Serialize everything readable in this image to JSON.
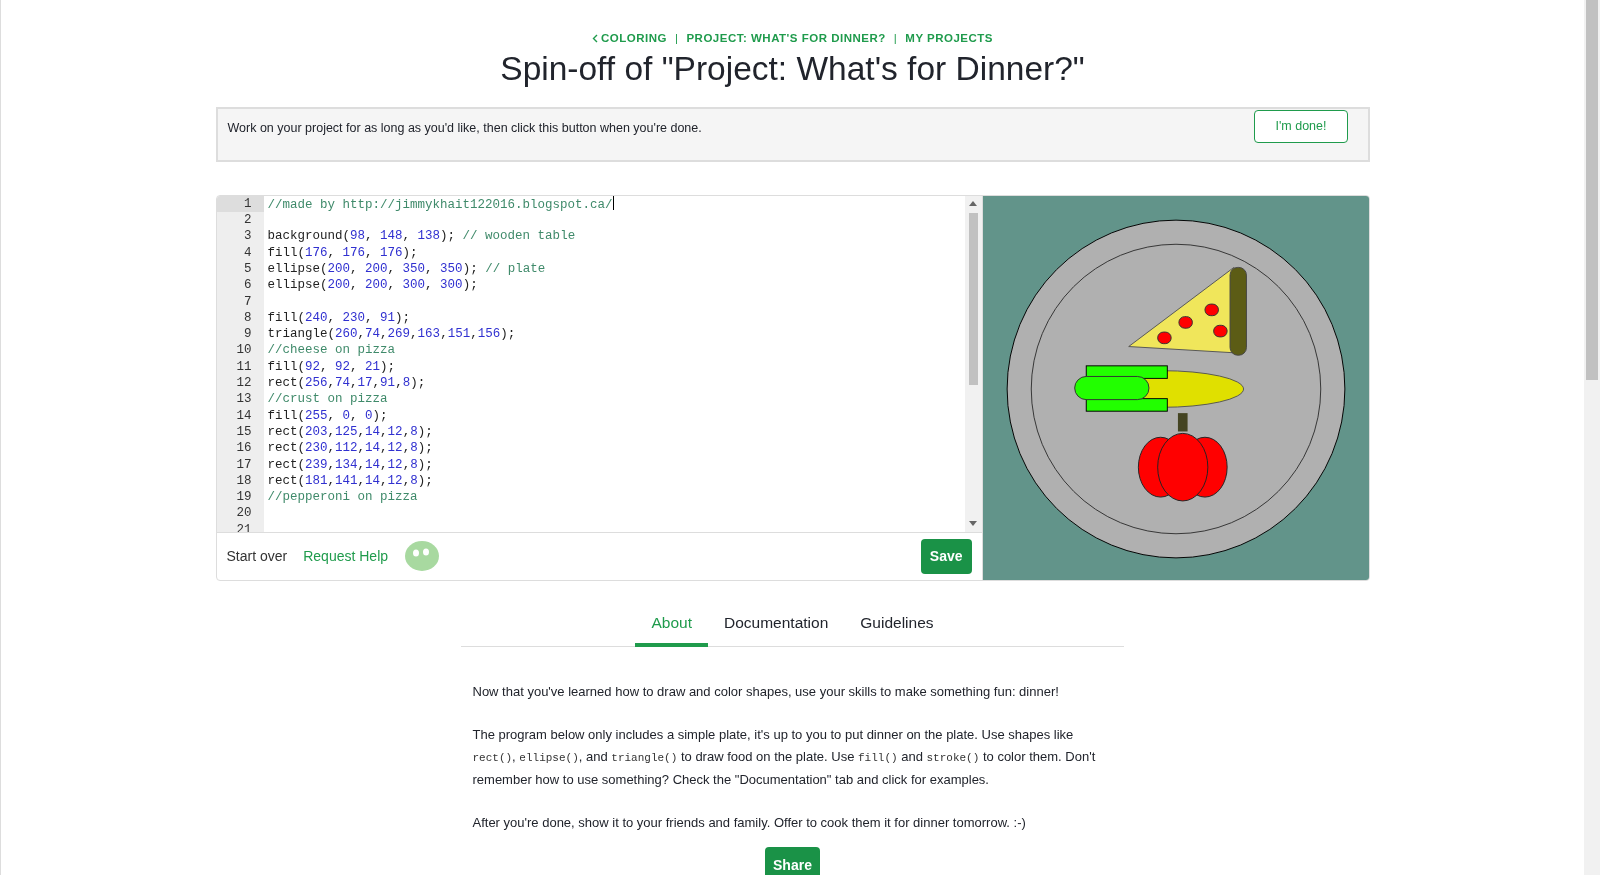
{
  "breadcrumbs": [
    {
      "kind": "back",
      "text": "COLORING"
    },
    {
      "kind": "separator",
      "text": "|"
    },
    {
      "kind": "link",
      "text": "PROJECT: WHAT'S FOR DINNER?"
    },
    {
      "kind": "separator",
      "text": "|"
    },
    {
      "kind": "link",
      "text": "MY PROJECTS"
    }
  ],
  "title": "Spin-off of \"Project: What's for Dinner?\"",
  "instructions": {
    "text": "Work on your project for as long as you'd like, then click this button when you're done.",
    "button": "I'm done!"
  },
  "editor": {
    "lines": [
      {
        "number": "1",
        "active": true,
        "tokens": [
          {
            "kind": "comment",
            "text": "//made by http://jimmykhait122016.blogspot.ca/"
          }
        ]
      },
      {
        "number": "2",
        "active": false
      },
      {
        "number": "3",
        "active": false,
        "tokens": [
          {
            "kind": "plain",
            "text": "background("
          },
          {
            "kind": "number",
            "text": "98"
          },
          {
            "kind": "plain",
            "text": ", "
          },
          {
            "kind": "number",
            "text": "148"
          },
          {
            "kind": "plain",
            "text": ", "
          },
          {
            "kind": "number",
            "text": "138"
          },
          {
            "kind": "plain",
            "text": "); "
          },
          {
            "kind": "comment",
            "text": "// wooden table"
          }
        ]
      },
      {
        "number": "4",
        "active": false,
        "tokens": [
          {
            "kind": "plain",
            "text": "fill("
          },
          {
            "kind": "number",
            "text": "176"
          },
          {
            "kind": "plain",
            "text": ", "
          },
          {
            "kind": "number",
            "text": "176"
          },
          {
            "kind": "plain",
            "text": ", "
          },
          {
            "kind": "number",
            "text": "176"
          },
          {
            "kind": "plain",
            "text": ");"
          }
        ]
      },
      {
        "number": "5",
        "active": false,
        "tokens": [
          {
            "kind": "plain",
            "text": "ellipse("
          },
          {
            "kind": "number",
            "text": "200"
          },
          {
            "kind": "plain",
            "text": ", "
          },
          {
            "kind": "number",
            "text": "200"
          },
          {
            "kind": "plain",
            "text": ", "
          },
          {
            "kind": "number",
            "text": "350"
          },
          {
            "kind": "plain",
            "text": ", "
          },
          {
            "kind": "number",
            "text": "350"
          },
          {
            "kind": "plain",
            "text": "); "
          },
          {
            "kind": "comment",
            "text": "// plate"
          }
        ]
      },
      {
        "number": "6",
        "active": false,
        "tokens": [
          {
            "kind": "plain",
            "text": "ellipse("
          },
          {
            "kind": "number",
            "text": "200"
          },
          {
            "kind": "plain",
            "text": ", "
          },
          {
            "kind": "number",
            "text": "200"
          },
          {
            "kind": "plain",
            "text": ", "
          },
          {
            "kind": "number",
            "text": "300"
          },
          {
            "kind": "plain",
            "text": ", "
          },
          {
            "kind": "number",
            "text": "300"
          },
          {
            "kind": "plain",
            "text": ");"
          }
        ]
      },
      {
        "number": "7",
        "active": false
      },
      {
        "number": "8",
        "active": false,
        "tokens": [
          {
            "kind": "plain",
            "text": "fill("
          },
          {
            "kind": "number",
            "text": "240"
          },
          {
            "kind": "plain",
            "text": ", "
          },
          {
            "kind": "number",
            "text": "230"
          },
          {
            "kind": "plain",
            "text": ", "
          },
          {
            "kind": "number",
            "text": "91"
          },
          {
            "kind": "plain",
            "text": ");"
          }
        ]
      },
      {
        "number": "9",
        "active": false,
        "tokens": [
          {
            "kind": "plain",
            "text": "triangle("
          },
          {
            "kind": "number",
            "text": "260"
          },
          {
            "kind": "plain",
            "text": ","
          },
          {
            "kind": "number",
            "text": "74"
          },
          {
            "kind": "plain",
            "text": ","
          },
          {
            "kind": "number",
            "text": "269"
          },
          {
            "kind": "plain",
            "text": ","
          },
          {
            "kind": "number",
            "text": "163"
          },
          {
            "kind": "plain",
            "text": ","
          },
          {
            "kind": "number",
            "text": "151"
          },
          {
            "kind": "plain",
            "text": ","
          },
          {
            "kind": "number",
            "text": "156"
          },
          {
            "kind": "plain",
            "text": ");"
          }
        ]
      },
      {
        "number": "10",
        "active": false,
        "tokens": [
          {
            "kind": "comment",
            "text": "//cheese on pizza"
          }
        ]
      },
      {
        "number": "11",
        "active": false,
        "tokens": [
          {
            "kind": "plain",
            "text": "fill("
          },
          {
            "kind": "number",
            "text": "92"
          },
          {
            "kind": "plain",
            "text": ", "
          },
          {
            "kind": "number",
            "text": "92"
          },
          {
            "kind": "plain",
            "text": ", "
          },
          {
            "kind": "number",
            "text": "21"
          },
          {
            "kind": "plain",
            "text": ");"
          }
        ]
      },
      {
        "number": "12",
        "active": false,
        "tokens": [
          {
            "kind": "plain",
            "text": "rect("
          },
          {
            "kind": "number",
            "text": "256"
          },
          {
            "kind": "plain",
            "text": ","
          },
          {
            "kind": "number",
            "text": "74"
          },
          {
            "kind": "plain",
            "text": ","
          },
          {
            "kind": "number",
            "text": "17"
          },
          {
            "kind": "plain",
            "text": ","
          },
          {
            "kind": "number",
            "text": "91"
          },
          {
            "kind": "plain",
            "text": ","
          },
          {
            "kind": "number",
            "text": "8"
          },
          {
            "kind": "plain",
            "text": ");"
          }
        ]
      },
      {
        "number": "13",
        "active": false,
        "tokens": [
          {
            "kind": "comment",
            "text": "//crust on pizza"
          }
        ]
      },
      {
        "number": "14",
        "active": false,
        "tokens": [
          {
            "kind": "plain",
            "text": "fill("
          },
          {
            "kind": "number",
            "text": "255"
          },
          {
            "kind": "plain",
            "text": ", "
          },
          {
            "kind": "number",
            "text": "0"
          },
          {
            "kind": "plain",
            "text": ", "
          },
          {
            "kind": "number",
            "text": "0"
          },
          {
            "kind": "plain",
            "text": ");"
          }
        ]
      },
      {
        "number": "15",
        "active": false,
        "tokens": [
          {
            "kind": "plain",
            "text": "rect("
          },
          {
            "kind": "number",
            "text": "203"
          },
          {
            "kind": "plain",
            "text": ","
          },
          {
            "kind": "number",
            "text": "125"
          },
          {
            "kind": "plain",
            "text": ","
          },
          {
            "kind": "number",
            "text": "14"
          },
          {
            "kind": "plain",
            "text": ","
          },
          {
            "kind": "number",
            "text": "12"
          },
          {
            "kind": "plain",
            "text": ","
          },
          {
            "kind": "number",
            "text": "8"
          },
          {
            "kind": "plain",
            "text": ");"
          }
        ]
      },
      {
        "number": "16",
        "active": false,
        "tokens": [
          {
            "kind": "plain",
            "text": "rect("
          },
          {
            "kind": "number",
            "text": "230"
          },
          {
            "kind": "plain",
            "text": ","
          },
          {
            "kind": "number",
            "text": "112"
          },
          {
            "kind": "plain",
            "text": ","
          },
          {
            "kind": "number",
            "text": "14"
          },
          {
            "kind": "plain",
            "text": ","
          },
          {
            "kind": "number",
            "text": "12"
          },
          {
            "kind": "plain",
            "text": ","
          },
          {
            "kind": "number",
            "text": "8"
          },
          {
            "kind": "plain",
            "text": ");"
          }
        ]
      },
      {
        "number": "17",
        "active": false,
        "tokens": [
          {
            "kind": "plain",
            "text": "rect("
          },
          {
            "kind": "number",
            "text": "239"
          },
          {
            "kind": "plain",
            "text": ","
          },
          {
            "kind": "number",
            "text": "134"
          },
          {
            "kind": "plain",
            "text": ","
          },
          {
            "kind": "number",
            "text": "14"
          },
          {
            "kind": "plain",
            "text": ","
          },
          {
            "kind": "number",
            "text": "12"
          },
          {
            "kind": "plain",
            "text": ","
          },
          {
            "kind": "number",
            "text": "8"
          },
          {
            "kind": "plain",
            "text": ");"
          }
        ]
      },
      {
        "number": "18",
        "active": false,
        "tokens": [
          {
            "kind": "plain",
            "text": "rect("
          },
          {
            "kind": "number",
            "text": "181"
          },
          {
            "kind": "plain",
            "text": ","
          },
          {
            "kind": "number",
            "text": "141"
          },
          {
            "kind": "plain",
            "text": ","
          },
          {
            "kind": "number",
            "text": "14"
          },
          {
            "kind": "plain",
            "text": ","
          },
          {
            "kind": "number",
            "text": "12"
          },
          {
            "kind": "plain",
            "text": ","
          },
          {
            "kind": "number",
            "text": "8"
          },
          {
            "kind": "plain",
            "text": ");"
          }
        ]
      },
      {
        "number": "19",
        "active": false,
        "tokens": [
          {
            "kind": "comment",
            "text": "//pepperoni on pizza"
          }
        ]
      },
      {
        "number": "20",
        "active": false
      },
      {
        "number": "21",
        "active": false
      }
    ]
  },
  "footer": {
    "start_over": "Start over",
    "request_help": "Request Help",
    "save": "Save"
  },
  "tabs": [
    {
      "label": "About",
      "selected": true
    },
    {
      "label": "Documentation",
      "selected": false
    },
    {
      "label": "Guidelines",
      "selected": false
    }
  ],
  "description": [
    [
      {
        "kind": "text",
        "text": "Now that you've learned how to draw and color shapes, use your skills to make something fun: dinner!"
      }
    ],
    [
      {
        "kind": "text",
        "text": "The program below only includes a simple plate, it's up to you to put dinner on the plate. Use shapes like "
      },
      {
        "kind": "code",
        "text": "rect()"
      },
      {
        "kind": "text",
        "text": ", "
      },
      {
        "kind": "code",
        "text": "ellipse()"
      },
      {
        "kind": "text",
        "text": ", and "
      },
      {
        "kind": "code",
        "text": "triangle()"
      },
      {
        "kind": "text",
        "text": " to draw food on the plate. Use "
      },
      {
        "kind": "code",
        "text": "fill()"
      },
      {
        "kind": "text",
        "text": " and "
      },
      {
        "kind": "code",
        "text": "stroke()"
      },
      {
        "kind": "text",
        "text": " to color them. Don't remember how to use something? Check the \"Documentation\" tab and click for examples."
      }
    ],
    [
      {
        "kind": "text",
        "text": "After you're done, show it to your friends and family. Offer to cook them it for dinner tomorrow. :-)"
      }
    ]
  ],
  "share_button": "Share"
}
